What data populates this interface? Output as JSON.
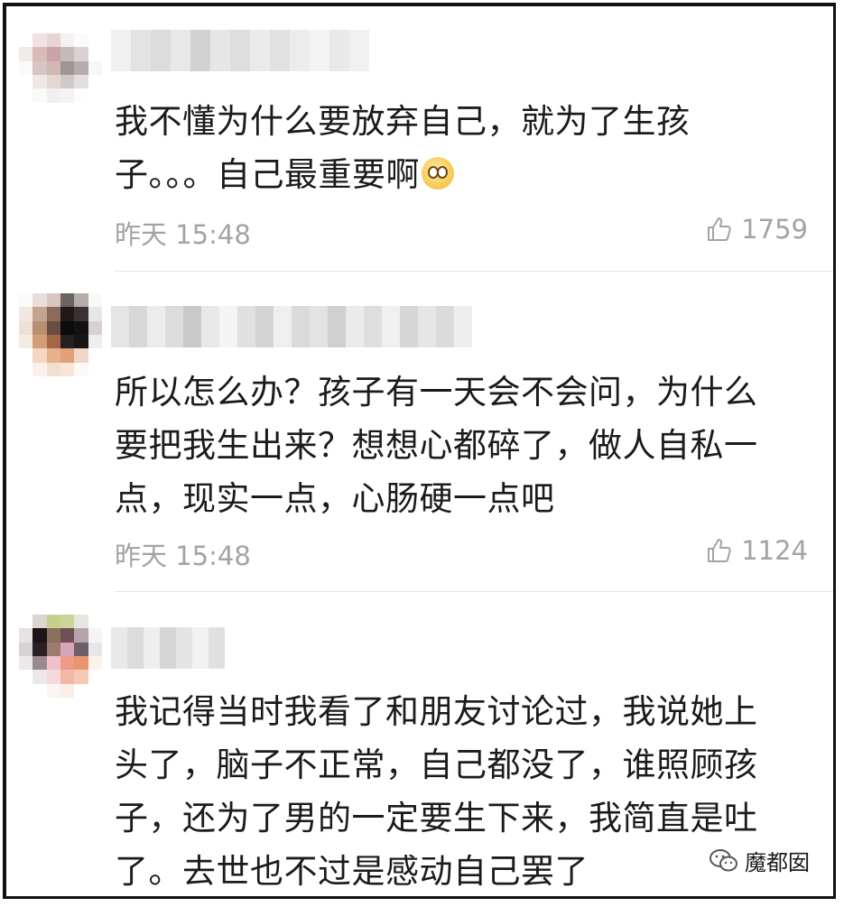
{
  "comments": [
    {
      "text_lines": [
        "我不懂为什么要放弃自己，就为了生孩",
        "子。。。自己最重要啊"
      ],
      "time": "昨天 15:48",
      "likes": "1759",
      "emoji": "face-holding-back-tears-emoji"
    },
    {
      "text_lines": [
        "所以怎么办？孩子有一天会不会问，为什么",
        "要把我生出来？想想心都碎了，做人自私一",
        "点，现实一点，心肠硬一点吧"
      ],
      "time": "昨天 15:48",
      "likes": "1124"
    },
    {
      "text_lines": [
        "我记得当时我看了和朋友讨论过，我说她上",
        "头了，脑子不正常，自己都没了，谁照顾孩",
        "子，还为了男的一定要生下来，我简直是吐",
        "了。去世也不过是感动自己罢了"
      ]
    }
  ],
  "watermark": {
    "label": "魔都囡",
    "icon": "wechat-icon"
  },
  "colors": {
    "text": "#1b1b1b",
    "meta": "#a3a3a3",
    "divider": "#e4e4e4",
    "border": "#111111"
  }
}
